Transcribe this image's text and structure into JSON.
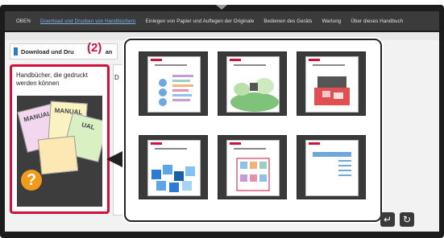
{
  "nav": {
    "items": [
      "OBEN",
      "Download und Drucken von Handbüchern",
      "Einlegen von Papier und Auflegen der Originale",
      "Bedienen des Geräts",
      "Wartung",
      "Über dieses Handbuch"
    ],
    "active_index": 1
  },
  "header": {
    "title": "Download und Dru",
    "title_suffix": "an"
  },
  "step_label": "(2)",
  "card": {
    "title": "Handbücher, die gedruckt werden können",
    "manual_labels": [
      "MANUAL",
      "MANUAL",
      "UAL"
    ],
    "help_glyph": "?"
  },
  "partial_text": "D",
  "thumbnails": [
    {
      "name": "thumb-1",
      "style": "chart"
    },
    {
      "name": "thumb-2",
      "style": "scene"
    },
    {
      "name": "thumb-3",
      "style": "photo"
    },
    {
      "name": "thumb-4",
      "style": "pattern"
    },
    {
      "name": "thumb-5",
      "style": "grid"
    },
    {
      "name": "thumb-6",
      "style": "form"
    }
  ],
  "controls": {
    "back_glyph": "↵",
    "refresh_glyph": "↻"
  },
  "colors": {
    "accent": "#d0103a",
    "nav_active": "#7fb3e8",
    "tab_marker": "#2a7bd1",
    "help_icon": "#f29a1a"
  }
}
